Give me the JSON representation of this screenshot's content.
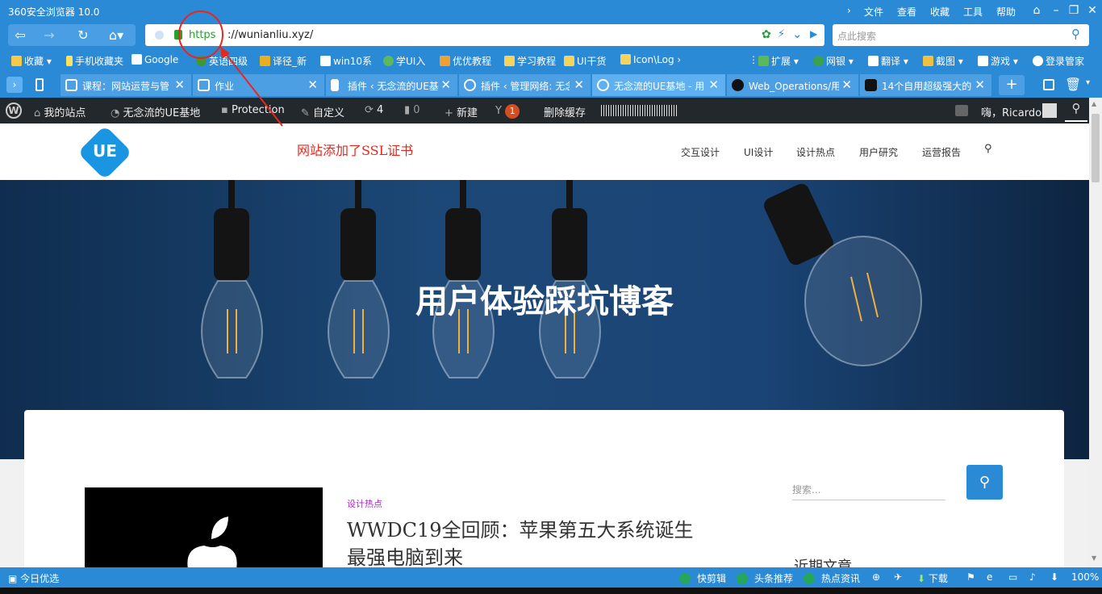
{
  "window": {
    "title": "360安全浏览器 10.0"
  },
  "menu": [
    "文件",
    "查看",
    "收藏",
    "工具",
    "帮助"
  ],
  "address": {
    "protocol": "https",
    "host": "://wunianliu.xyz/"
  },
  "search": {
    "placeholder": "点此搜索"
  },
  "bookmarks": [
    "收藏",
    "手机收藏夹",
    "Google",
    "英语四级",
    "译径_新",
    "win10系",
    "学UI入",
    "优优教程",
    "学习教程",
    "UI干货",
    "Icon\\Log"
  ],
  "bookmark_tools": [
    "扩展",
    "网银",
    "翻译",
    "截图",
    "游戏",
    "登录管家"
  ],
  "tabs": [
    {
      "label": "课程：网站运营与管"
    },
    {
      "label": "作业"
    },
    {
      "label": "插件 ‹ 无念流的UE基"
    },
    {
      "label": "插件 ‹ 管理网络: 无念"
    },
    {
      "label": "无念流的UE基地 - 用"
    },
    {
      "label": "Web_Operations/用"
    },
    {
      "label": "14个自用超级强大的"
    }
  ],
  "wp_bar": {
    "my_sites": "我的站点",
    "site_name": "无念流的UE基地",
    "protection": "Protection",
    "customize": "自定义",
    "updates": "4",
    "comments": "0",
    "new": "新建",
    "yoast_count": "1",
    "purge": "删除缓存",
    "greeting": "嗨，Ricardo"
  },
  "annotation": {
    "note": "网站添加了SSL证书"
  },
  "site": {
    "logo_text": "UE",
    "nav": [
      "交互设计",
      "UI设计",
      "设计热点",
      "用户研究",
      "运营报告"
    ],
    "hero_title": "用户体验踩坑博客"
  },
  "post": {
    "category": "设计热点",
    "title": "WWDC19全回顾：苹果第五大系统诞生 最强电脑到来"
  },
  "sidebar": {
    "search_placeholder": "搜索...",
    "recent_heading": "近期文章"
  },
  "status_bar": {
    "left": "今日优选",
    "items": [
      "快剪辑",
      "头条推荐",
      "热点资讯",
      "下载"
    ],
    "zoom": "100%"
  }
}
